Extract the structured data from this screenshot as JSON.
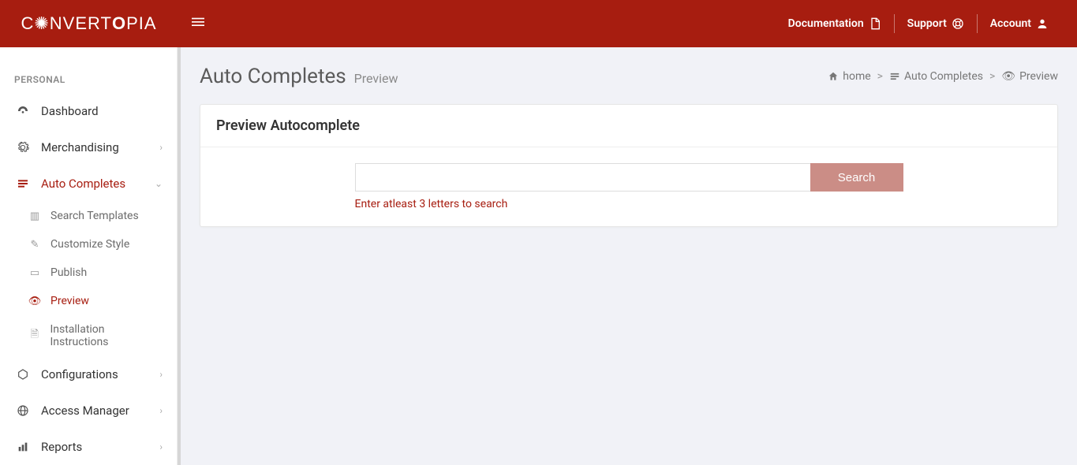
{
  "brand": "CONVERTOPIA",
  "topbar": {
    "documentation": "Documentation",
    "support": "Support",
    "account": "Account"
  },
  "sidebar": {
    "section": "PERSONAL",
    "items": {
      "dashboard": "Dashboard",
      "merchandising": "Merchandising",
      "autocompletes": "Auto Completes",
      "configurations": "Configurations",
      "access_manager": "Access Manager",
      "reports": "Reports"
    },
    "autocomplete_sub": {
      "search_templates": "Search Templates",
      "customize_style": "Customize Style",
      "publish": "Publish",
      "preview": "Preview",
      "installation": "Installation Instructions"
    }
  },
  "page": {
    "title": "Auto Completes",
    "subtitle": "Preview"
  },
  "breadcrumb": {
    "home": "home",
    "section": "Auto Completes",
    "current": "Preview"
  },
  "panel": {
    "title": "Preview Autocomplete",
    "search_button": "Search",
    "search_placeholder": "",
    "hint": "Enter atleast 3 letters to search"
  }
}
